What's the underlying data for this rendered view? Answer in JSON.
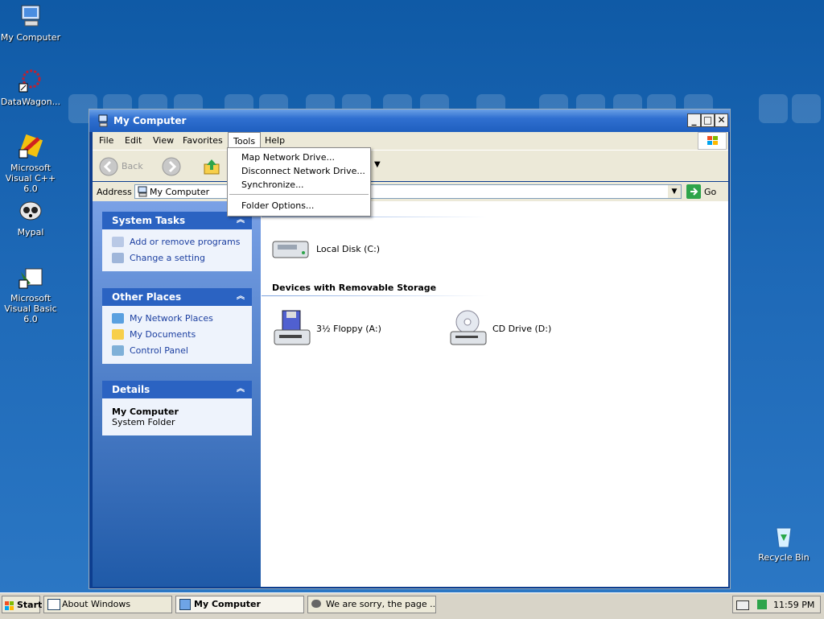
{
  "desktop": {
    "icons": [
      {
        "label": "My Computer"
      },
      {
        "label": "DataWagon..."
      },
      {
        "label": "Microsoft Visual C++ 6.0"
      },
      {
        "label": "Mypal"
      },
      {
        "label": "Microsoft Visual Basic 6.0"
      },
      {
        "label": "Recycle Bin"
      }
    ]
  },
  "window": {
    "title": "My Computer",
    "controls": {
      "minimize": "_",
      "maximize": "□",
      "close": "✕"
    },
    "menus": [
      "File",
      "Edit",
      "View",
      "Favorites",
      "Tools",
      "Help"
    ],
    "toolbar": {
      "back": "Back"
    },
    "address": {
      "label": "Address",
      "value": "My Computer",
      "go": "Go"
    }
  },
  "tools_menu": {
    "items": [
      "Map Network Drive...",
      "Disconnect Network Drive...",
      "Synchronize...",
      "Folder Options..."
    ]
  },
  "left_pane": {
    "system_tasks": {
      "title": "System Tasks",
      "links": [
        "Add or remove programs",
        "Change a setting"
      ]
    },
    "other_places": {
      "title": "Other Places",
      "links": [
        "My Network Places",
        "My Documents",
        "Control Panel"
      ]
    },
    "details": {
      "title": "Details",
      "name": "My Computer",
      "type": "System Folder"
    }
  },
  "main": {
    "drives": [
      {
        "label": "Local Disk (C:)"
      }
    ],
    "removable_heading": "Devices with Removable Storage",
    "removable": [
      {
        "label": "3½ Floppy (A:)"
      },
      {
        "label": "CD Drive (D:)"
      }
    ]
  },
  "taskbar": {
    "start": "Start",
    "tasks": [
      "About Windows",
      "My Computer",
      "We are sorry, the page ..."
    ],
    "clock": "11:59 PM"
  },
  "colors": {
    "accent": "#2f6fd0",
    "desktop": "#1e69b7",
    "menu_bg": "#ece9d8"
  }
}
